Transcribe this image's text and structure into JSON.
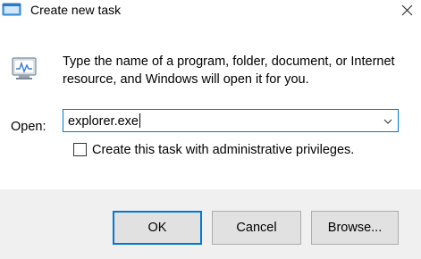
{
  "window": {
    "title": "Create new task",
    "title_icon": "run-icon",
    "close_icon": "close-icon"
  },
  "description": "Type the name of a program, folder, document, or Internet resource, and Windows will open it for you.",
  "description_icon": "run-program-icon",
  "open_field": {
    "label": "Open:",
    "value": "explorer.exe",
    "dropdown_icon": "chevron-down-icon"
  },
  "admin_checkbox": {
    "label": "Create this task with administrative privileges.",
    "checked": false
  },
  "buttons": {
    "ok": "OK",
    "cancel": "Cancel",
    "browse": "Browse..."
  },
  "colors": {
    "accent": "#0078d7",
    "footer_bg": "#f0f0f0",
    "button_bg": "#e1e1e1",
    "button_border": "#adadad"
  }
}
